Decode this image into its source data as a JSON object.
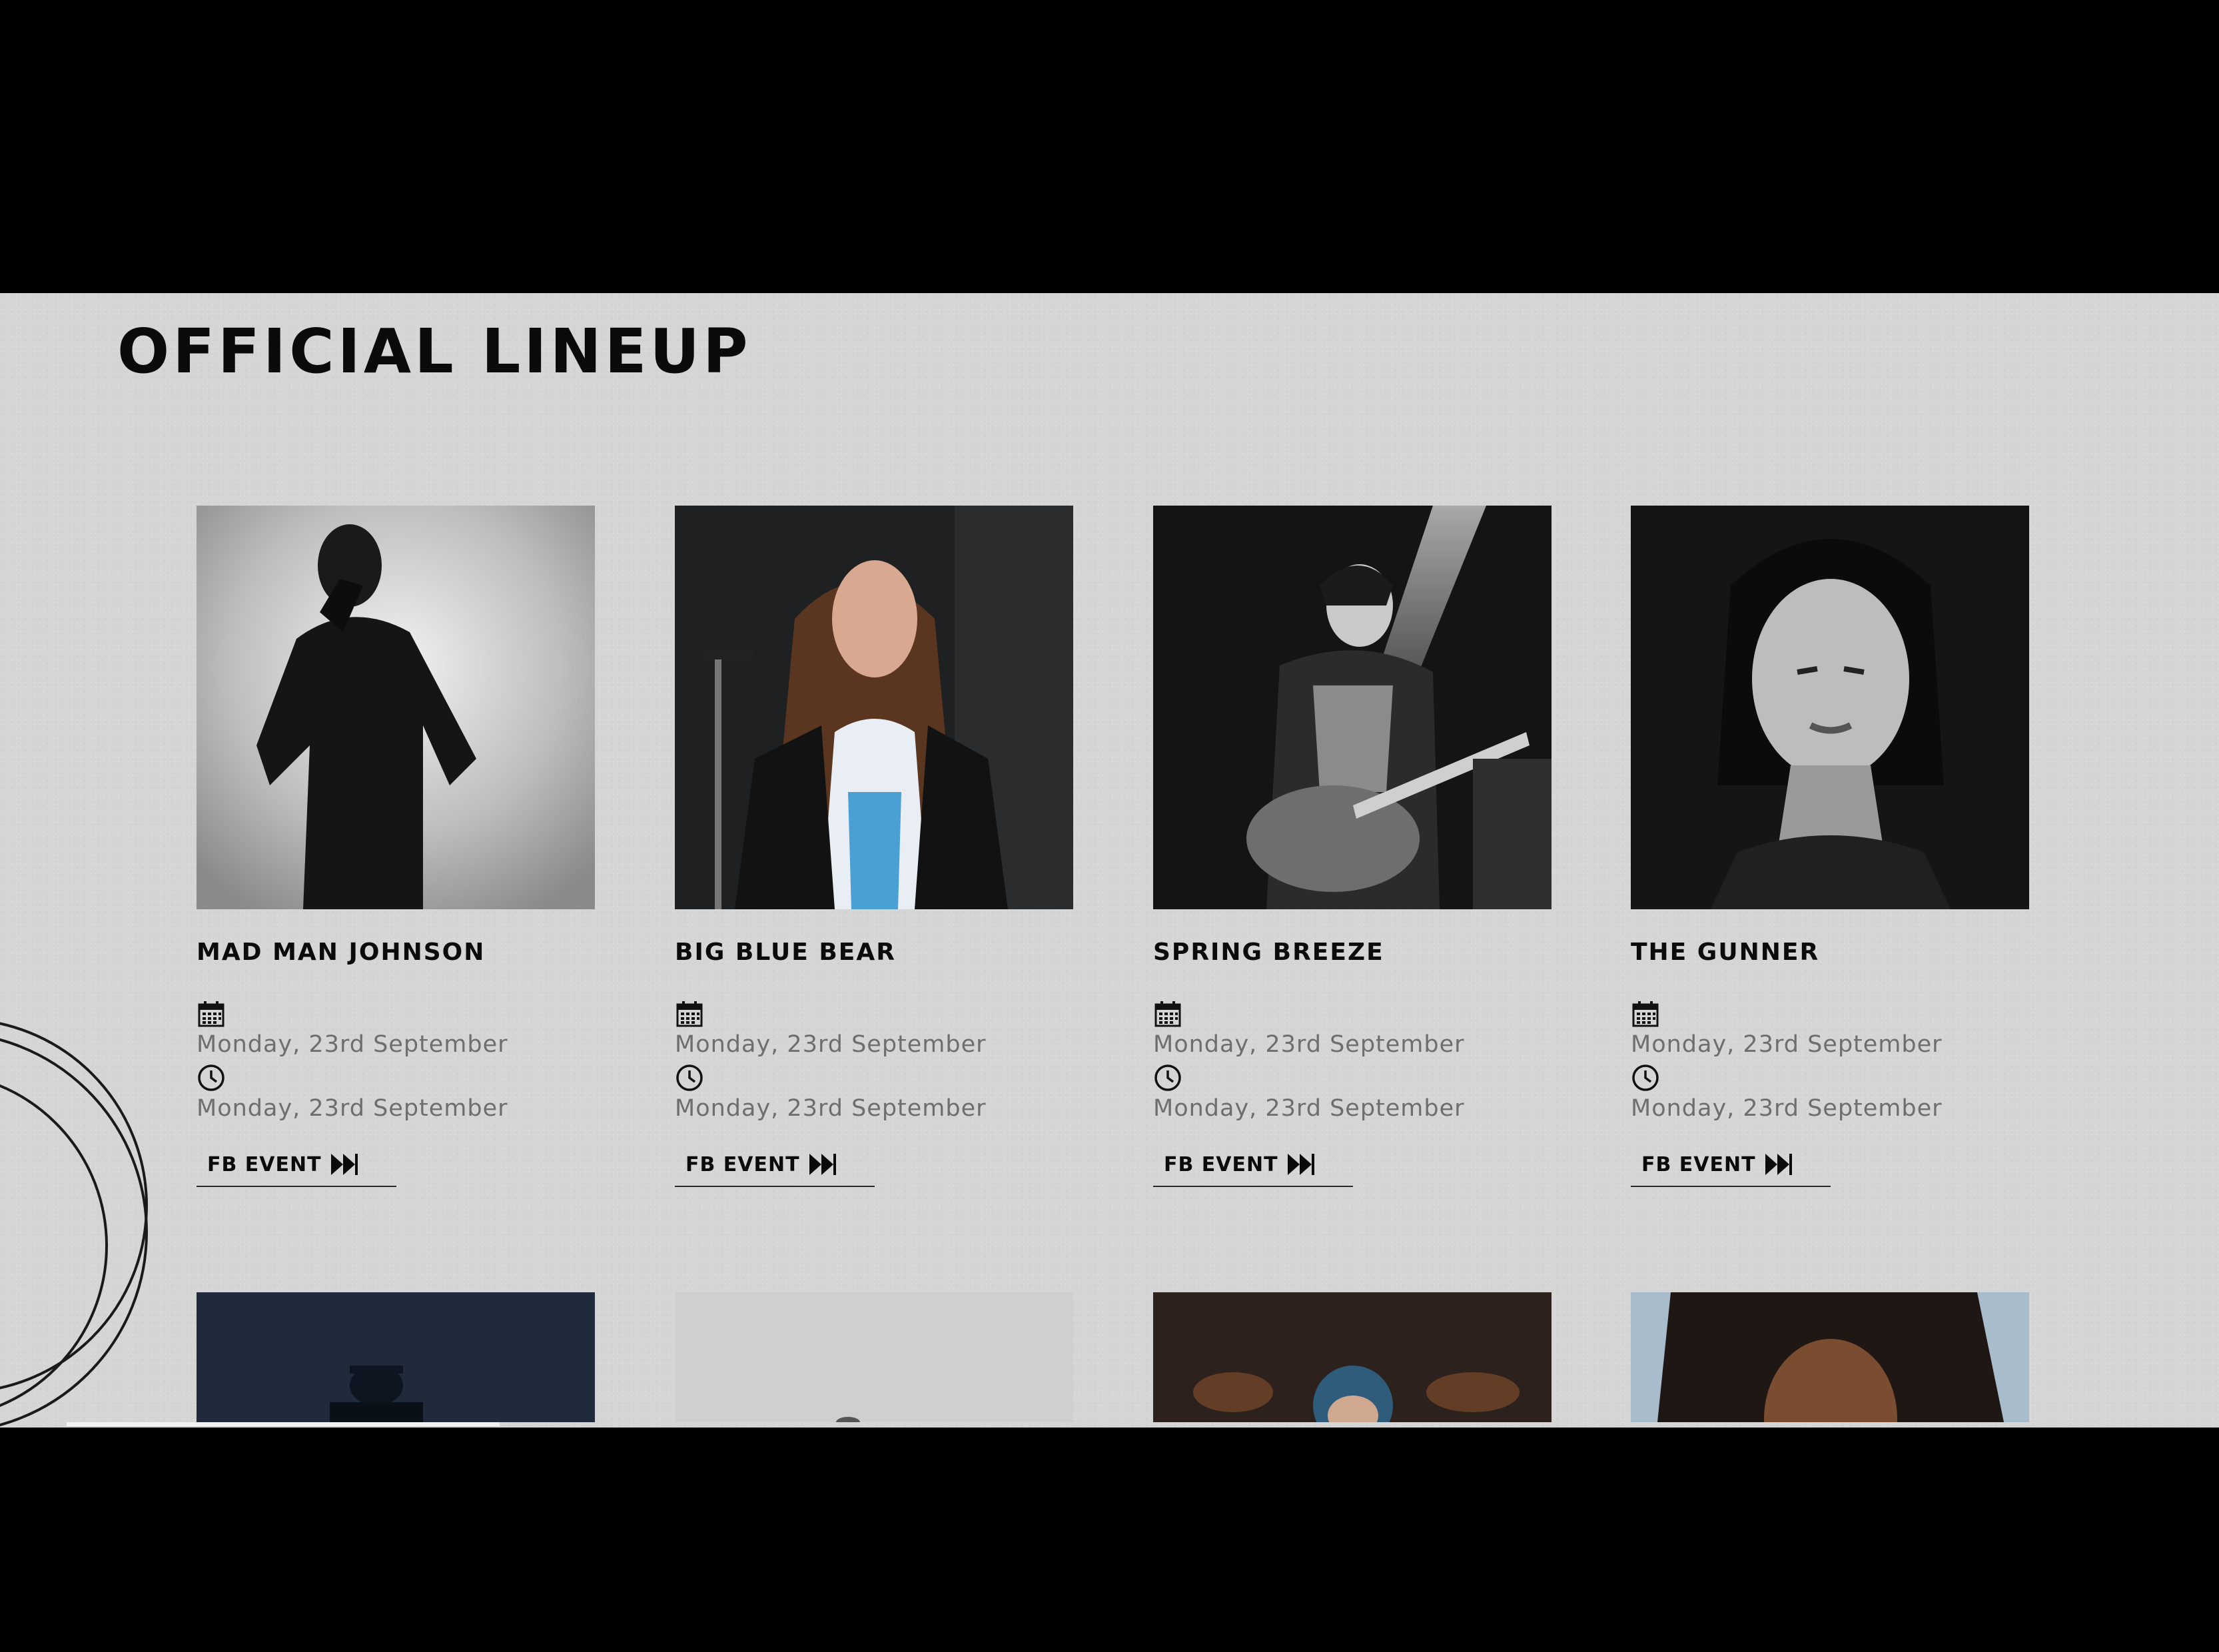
{
  "lineup": {
    "title": "OFFICIAL LINEUP",
    "artists": [
      {
        "name": "MAD MAN JOHNSON",
        "date": "Monday, 23rd September",
        "time": "Monday, 23rd September",
        "link_label": "FB EVENT"
      },
      {
        "name": "BIG BLUE BEAR",
        "date": "Monday, 23rd September",
        "time": "Monday, 23rd September",
        "link_label": "FB EVENT"
      },
      {
        "name": "SPRING BREEZE",
        "date": "Monday, 23rd September",
        "time": "Monday, 23rd September",
        "link_label": "FB EVENT"
      },
      {
        "name": "THE GUNNER",
        "date": "Monday, 23rd September",
        "time": "Monday, 23rd September",
        "link_label": "FB EVENT"
      }
    ],
    "icons": {
      "date": "calendar-icon",
      "time": "clock-icon",
      "link": "fast-forward-icon"
    }
  },
  "colors": {
    "background": "#d5d5d5",
    "text": "#0b0b0b",
    "meta_text": "#6e6e6e"
  }
}
